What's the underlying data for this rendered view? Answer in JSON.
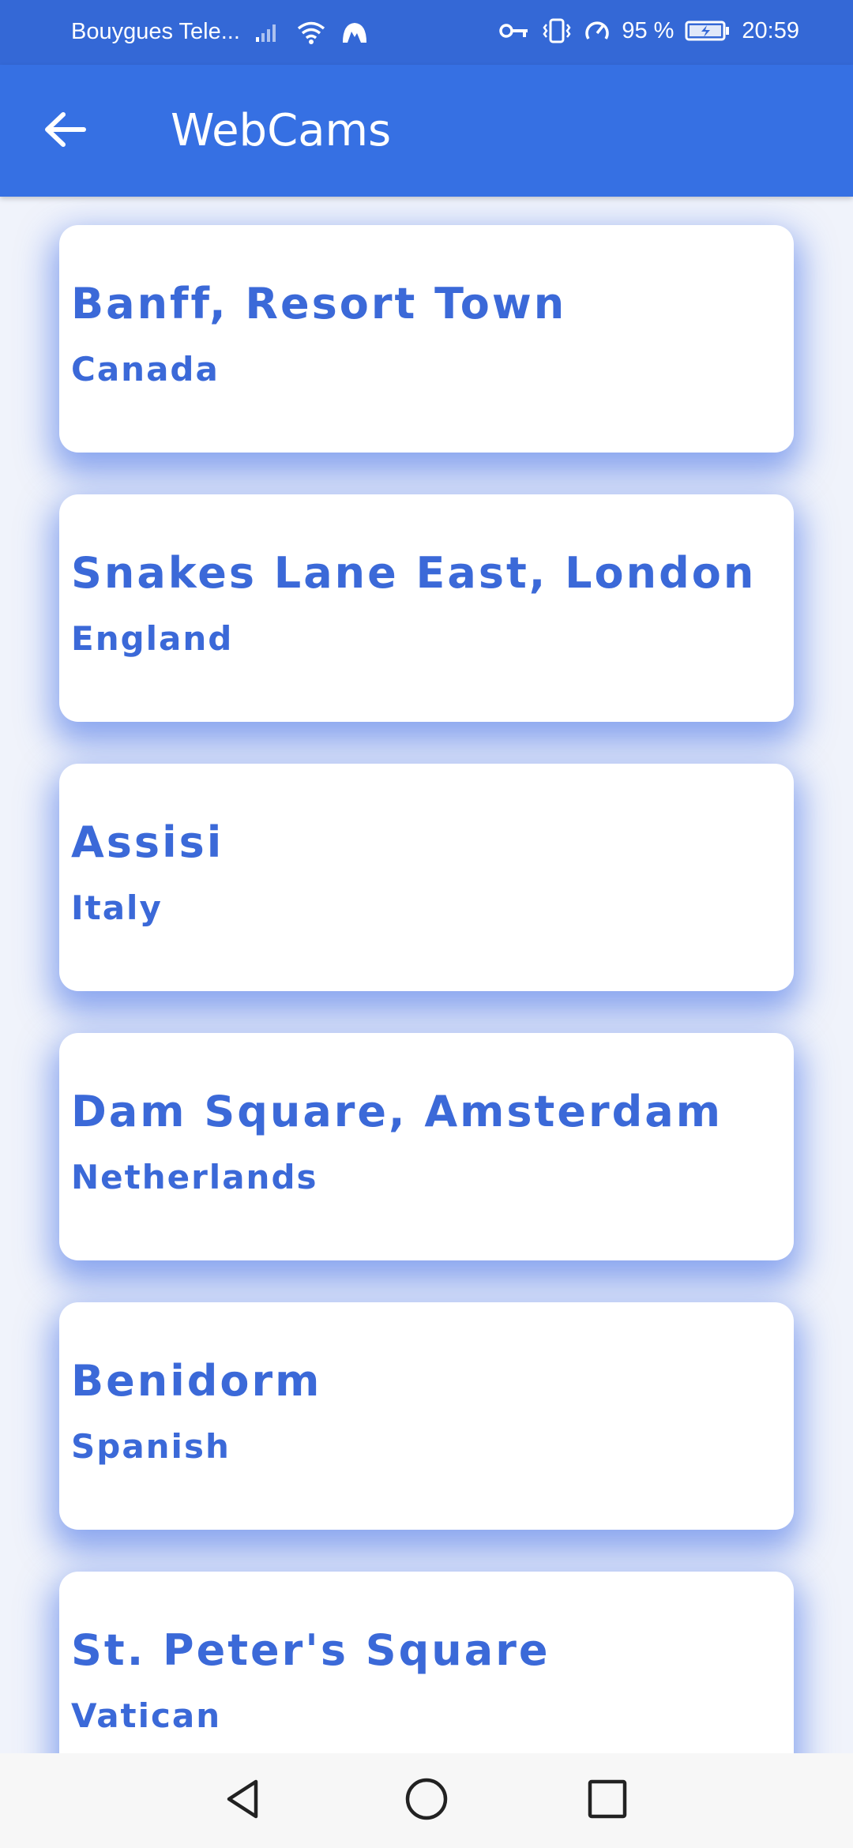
{
  "status_bar": {
    "carrier": "Bouygues Tele...",
    "battery_percent": "95 %",
    "time": "20:59",
    "icons": [
      "signal-icon",
      "wifi-icon",
      "app-notification-icon",
      "vpn-key-icon",
      "vibrate-icon",
      "data-saver-icon",
      "battery-charging-icon"
    ]
  },
  "app_bar": {
    "title": "WebCams",
    "back_icon": "arrow-left-icon"
  },
  "webcams": [
    {
      "title": "Banff, Resort Town",
      "country": "Canada"
    },
    {
      "title": "Snakes Lane East, London",
      "country": "England"
    },
    {
      "title": "Assisi",
      "country": "Italy"
    },
    {
      "title": "Dam Square, Amsterdam",
      "country": "Netherlands"
    },
    {
      "title": "Benidorm",
      "country": "Spanish"
    },
    {
      "title": "St. Peter's Square",
      "country": "Vatican"
    }
  ],
  "nav_bar": {
    "icons": [
      "back-triangle-icon",
      "home-circle-icon",
      "recents-square-icon"
    ]
  },
  "colors": {
    "primary": "#3670e3",
    "status_bar": "#3468d6",
    "card_text": "#3b69d8",
    "background": "#f0f3fb"
  }
}
